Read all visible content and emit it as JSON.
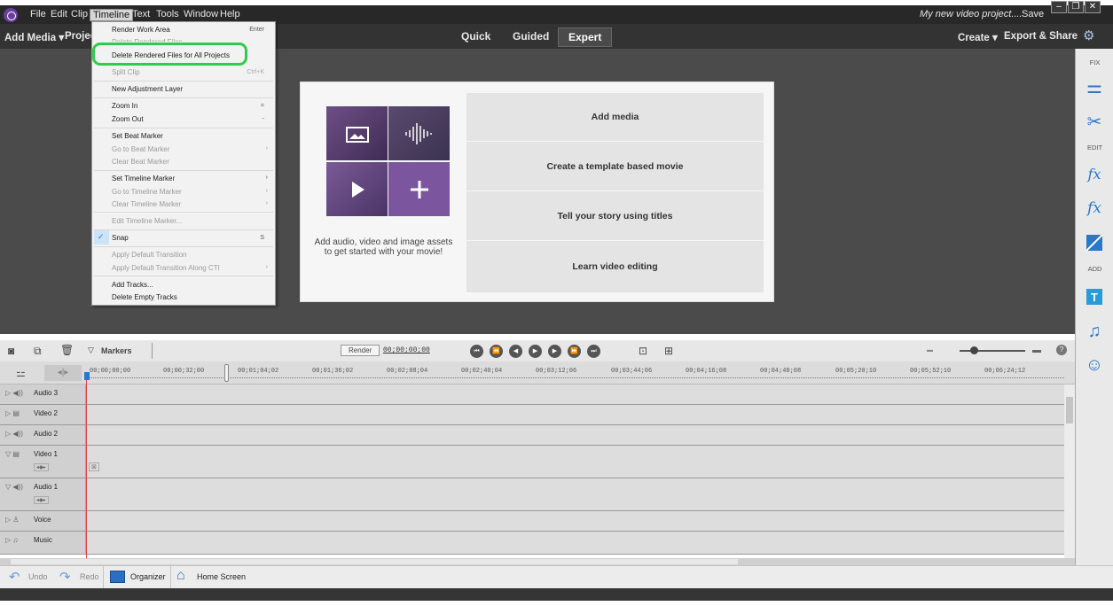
{
  "menubar": {
    "items": [
      "File",
      "Edit",
      "Clip",
      "Timeline",
      "Text",
      "Tools",
      "Window",
      "Help"
    ],
    "project_title": "My new video project....",
    "save": "Save",
    "window_buttons": [
      "–",
      "❐",
      "✕"
    ]
  },
  "toolbar": {
    "add_media": "Add Media ▾",
    "project": "Projec",
    "modes": [
      "Quick",
      "Guided",
      "Expert"
    ],
    "active_mode": "Expert",
    "create": "Create ▾",
    "export_share": "Export & Share"
  },
  "right_panel": {
    "sections": [
      "FIX",
      "EDIT",
      "ADD"
    ]
  },
  "start_card": {
    "message": "Add audio, video and image assets to get started with your movie!",
    "options": [
      "Add media",
      "Create a template based movie",
      "Tell your story using titles",
      "Learn video editing"
    ]
  },
  "timeline_bar": {
    "markers": "Markers",
    "render": "Render",
    "timecode": "00;00;00;00"
  },
  "ruler": {
    "timecodes": [
      "00;00;00;00",
      "00;00;32;00",
      "00;01;04;02",
      "00;01;36;02",
      "00;02;08;04",
      "00;02;40;04",
      "00;03;12;06",
      "00;03;44;06",
      "00;04;16;08",
      "00;04;48;08",
      "00;05;20;10",
      "00;05;52;10",
      "00;06;24;12"
    ]
  },
  "tracks": [
    "Audio 3",
    "Video 2",
    "Audio 2",
    "Video 1",
    "Audio 1",
    "Voice",
    "Music"
  ],
  "dropdown": {
    "items": [
      {
        "label": "Render Work Area",
        "shortcut": "Enter"
      },
      {
        "label": "Delete Rendered Files"
      },
      {
        "label": "Delete Rendered Files for All Projects"
      },
      {
        "label": "Split Clip",
        "shortcut": "Ctrl+K"
      },
      {
        "label": "New Adjustment Layer"
      },
      {
        "label": "Zoom In",
        "shortcut": "="
      },
      {
        "label": "Zoom Out",
        "shortcut": "-"
      },
      {
        "label": "Set Beat Marker"
      },
      {
        "label": "Go to Beat Marker"
      },
      {
        "label": "Clear Beat Marker"
      },
      {
        "label": "Set Timeline Marker"
      },
      {
        "label": "Go to Timeline Marker"
      },
      {
        "label": "Clear Timeline Marker"
      },
      {
        "label": "Edit Timeline Marker..."
      },
      {
        "label": "Snap",
        "shortcut": "S"
      },
      {
        "label": "Apply Default Transition"
      },
      {
        "label": "Apply Default Transition Along CTI"
      },
      {
        "label": "Add Tracks..."
      },
      {
        "label": "Delete Empty Tracks"
      }
    ]
  },
  "statusbar": {
    "undo": "Undo",
    "redo": "Redo",
    "organizer": "Organizer",
    "home_screen": "Home Screen"
  }
}
